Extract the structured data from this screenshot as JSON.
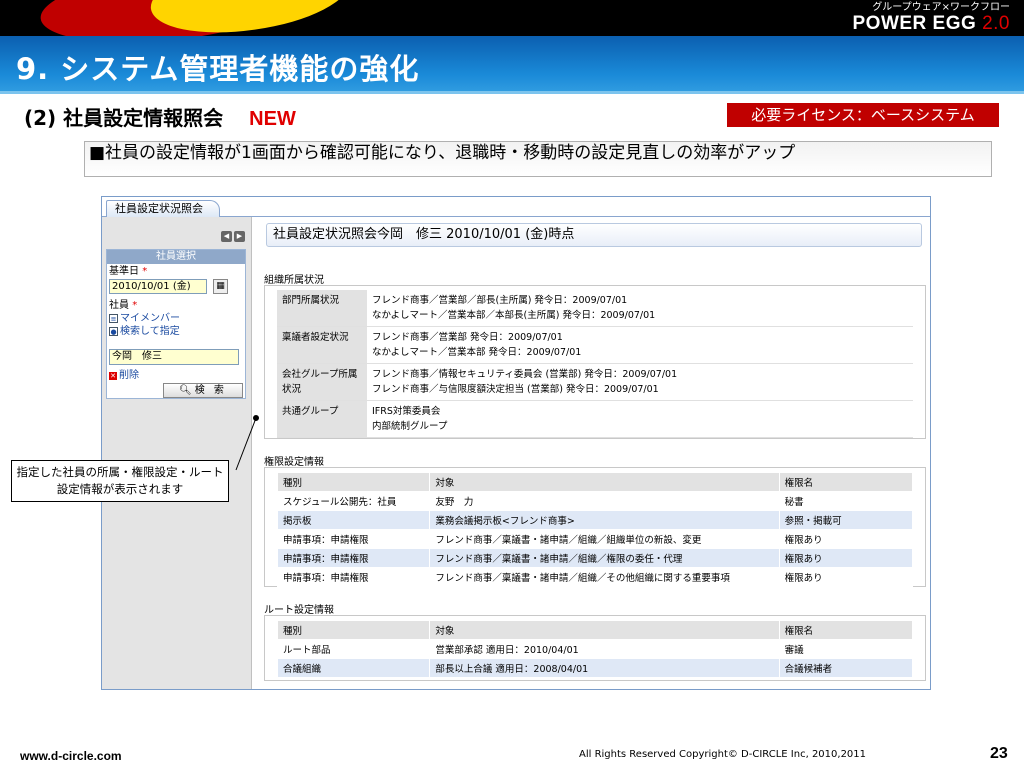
{
  "header": {
    "brand_sub": "グループウェア×ワークフロー",
    "brand_main": "POWER EGG",
    "brand_version": "2.0"
  },
  "slide": {
    "title": "9. システム管理者機能の強化",
    "subtitle": "(2) 社員設定情報照会",
    "new_badge": "NEW",
    "license": "必要ライセンス：ベースシステム",
    "bullet": "■社員の設定情報が1画面から確認可能になり、退職時・移動時の設定見直しの効率がアップ",
    "callout": "指定した社員の所属・権限設定・ルート設定情報が表示されます"
  },
  "app": {
    "tab_label": "社員設定状況照会",
    "nav_prev": "◀",
    "nav_next": "▶",
    "selector": {
      "heading": "社員選択",
      "date_label": "基準日",
      "date_value": "2010/10/01 (金)",
      "calendar_icon": "calendar-icon",
      "employee_label": "社員",
      "required_mark": "*",
      "link_my_members": "マイメンバー",
      "link_search": "検索して指定",
      "employee_value": "今岡　修三",
      "delete_label": "削除",
      "search_button": "検 索",
      "search_icon": "magnifier-icon"
    },
    "main_title": "社員設定状況照会今岡　修三 2010/10/01 (金)時点",
    "org_section": "組織所属状況",
    "org_rows": [
      {
        "key": "部門所属状況",
        "lines": [
          "フレンド商事／営業部／部長(主所属) 発令日：2009/07/01",
          "なかよしマート／営業本部／本部長(主所属) 発令日：2009/07/01"
        ]
      },
      {
        "key": "稟議者設定状況",
        "lines": [
          "フレンド商事／営業部 発令日：2009/07/01",
          "なかよしマート／営業本部 発令日：2009/07/01"
        ]
      },
      {
        "key": "会社グループ所属状況",
        "lines": [
          "フレンド商事／情報セキュリティ委員会 (営業部) 発令日：2009/07/01",
          "フレンド商事／与信限度額決定担当 (営業部) 発令日：2009/07/01"
        ]
      },
      {
        "key": "共通グループ",
        "lines": [
          "IFRS対策委員会",
          "内部統制グループ"
        ]
      }
    ],
    "auth_section": "権限設定情報",
    "auth_headers": [
      "種別",
      "対象",
      "権限名"
    ],
    "auth_rows": [
      [
        "スケジュール公開先：社員",
        "友野　力",
        "秘書"
      ],
      [
        "掲示板",
        "業務会議掲示板<フレンド商事>",
        "参照・掲載可"
      ],
      [
        "申請事項：申請権限",
        "フレンド商事／稟議書・諸申請／組織／組織単位の新設、変更",
        "権限あり"
      ],
      [
        "申請事項：申請権限",
        "フレンド商事／稟議書・諸申請／組織／権限の委任・代理",
        "権限あり"
      ],
      [
        "申請事項：申請権限",
        "フレンド商事／稟議書・諸申請／組織／その他組織に関する重要事項",
        "権限あり"
      ]
    ],
    "route_section": "ルート設定情報",
    "route_headers": [
      "種別",
      "対象",
      "権限名"
    ],
    "route_rows": [
      [
        "ルート部品",
        "営業部承認 適用日：2010/04/01",
        "審議"
      ],
      [
        "合議組織",
        "部長以上合議 適用日：2008/04/01",
        "合議候補者"
      ]
    ]
  },
  "footer": {
    "url": "www.d-circle.com",
    "copyright": "All Rights Reserved Copyright© D-CIRCLE Inc, 2010,2011",
    "page": "23"
  }
}
